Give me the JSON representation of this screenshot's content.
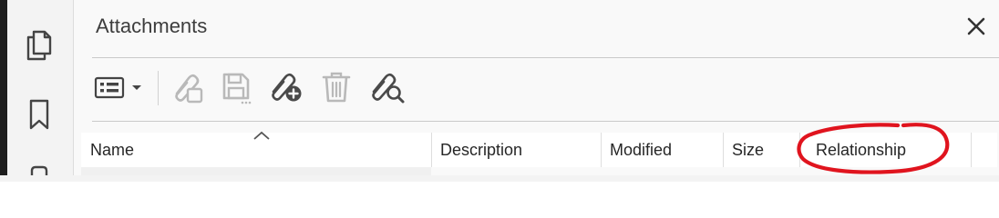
{
  "panel": {
    "title": "Attachments"
  },
  "nav_rail": {
    "items": [
      {
        "icon": "pages-icon"
      },
      {
        "icon": "bookmark-icon"
      },
      {
        "icon": "more-icon"
      }
    ]
  },
  "toolbar": {
    "items": [
      {
        "icon": "view-options-icon",
        "enabled": true
      },
      {
        "icon": "open-attachment-icon",
        "enabled": false
      },
      {
        "icon": "save-attachment-icon",
        "enabled": false
      },
      {
        "icon": "add-attachment-icon",
        "enabled": true
      },
      {
        "icon": "delete-icon",
        "enabled": false
      },
      {
        "icon": "search-attachments-icon",
        "enabled": true
      }
    ]
  },
  "columns": {
    "name": "Name",
    "description": "Description",
    "modified": "Modified",
    "size": "Size",
    "relationship": "Relationship"
  },
  "annotation": {
    "color": "#e0141e",
    "target": "Relationship"
  },
  "colors": {
    "disabled": "#b9b9b9",
    "enabled": "#4a4a4a"
  }
}
